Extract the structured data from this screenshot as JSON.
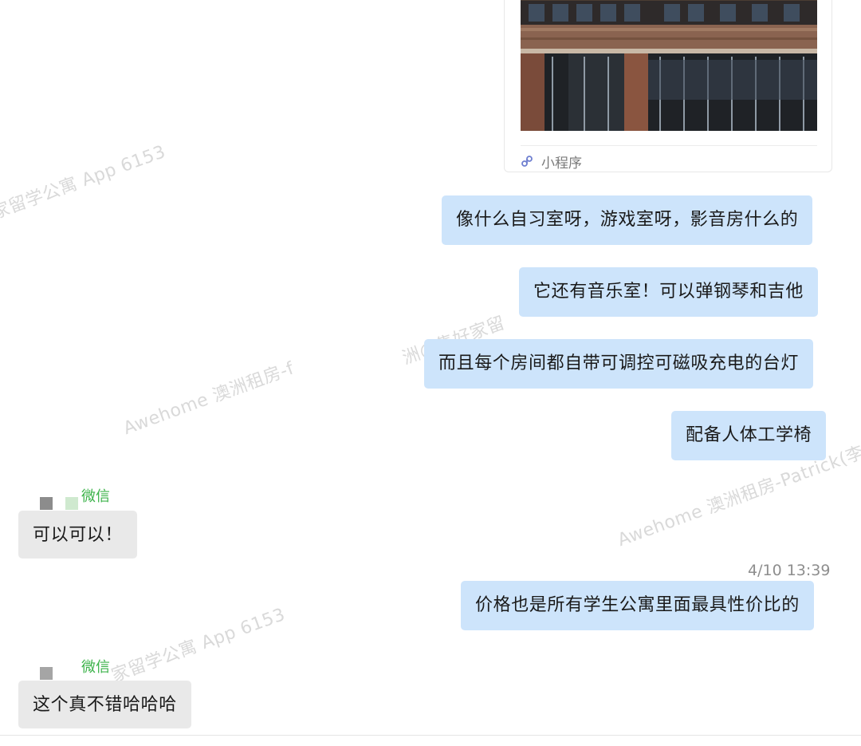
{
  "mini_program": {
    "label": "小程序",
    "icon": "mini-program-icon"
  },
  "messages": [
    {
      "text": "像什么自习室呀，游戏室呀，影音房什么的"
    },
    {
      "text": "它还有音乐室！可以弹钢琴和吉他"
    },
    {
      "text": "而且每个房间都自带可调控可磁吸充电的台灯"
    },
    {
      "text": "配备人体工学椅"
    },
    {
      "text": "可以可以！"
    },
    {
      "text": "价格也是所有学生公寓里面最具性价比的"
    },
    {
      "text": "这个真不错哈哈哈"
    }
  ],
  "sender_tags": [
    "微信",
    "微信"
  ],
  "timestamp": "4/10 13:39",
  "watermarks": [
    "家留学公寓 App 6153",
    "Awehome 澳洲租房-f",
    "洲@集好家留",
    "Awehome 澳洲租房-Patrick(李",
    "家留学公寓 App 6153"
  ],
  "colors": {
    "outgoing_bubble": "#cde4fb",
    "incoming_bubble": "#e9e9e9",
    "sender_tag": "#3cb34a"
  }
}
